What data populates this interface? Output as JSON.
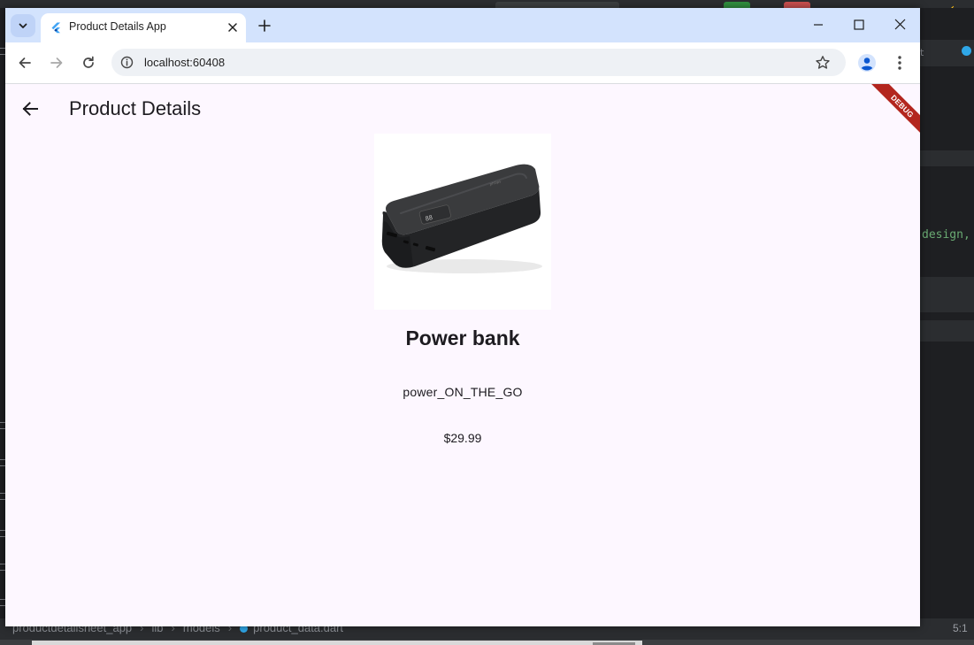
{
  "browser": {
    "tab_title": "Product Details App",
    "url": "localhost:60408"
  },
  "app": {
    "title": "Product Details",
    "debug_banner": "DEBUG",
    "product": {
      "name": "Power bank",
      "description": "power_ON_THE_GO",
      "price": "$29.99"
    }
  },
  "ide": {
    "code_fragment": "design,",
    "tab_fragment": "t",
    "breadcrumb": [
      "productdetailsheet_app",
      "lib",
      "models",
      "product_data.dart"
    ],
    "cursor_position": "5:1"
  },
  "colors": {
    "app_background": "#fdf7ff",
    "tab_strip": "#d3e3fd",
    "debug_banner": "#b3261e",
    "ide_background": "#1e1f22"
  }
}
